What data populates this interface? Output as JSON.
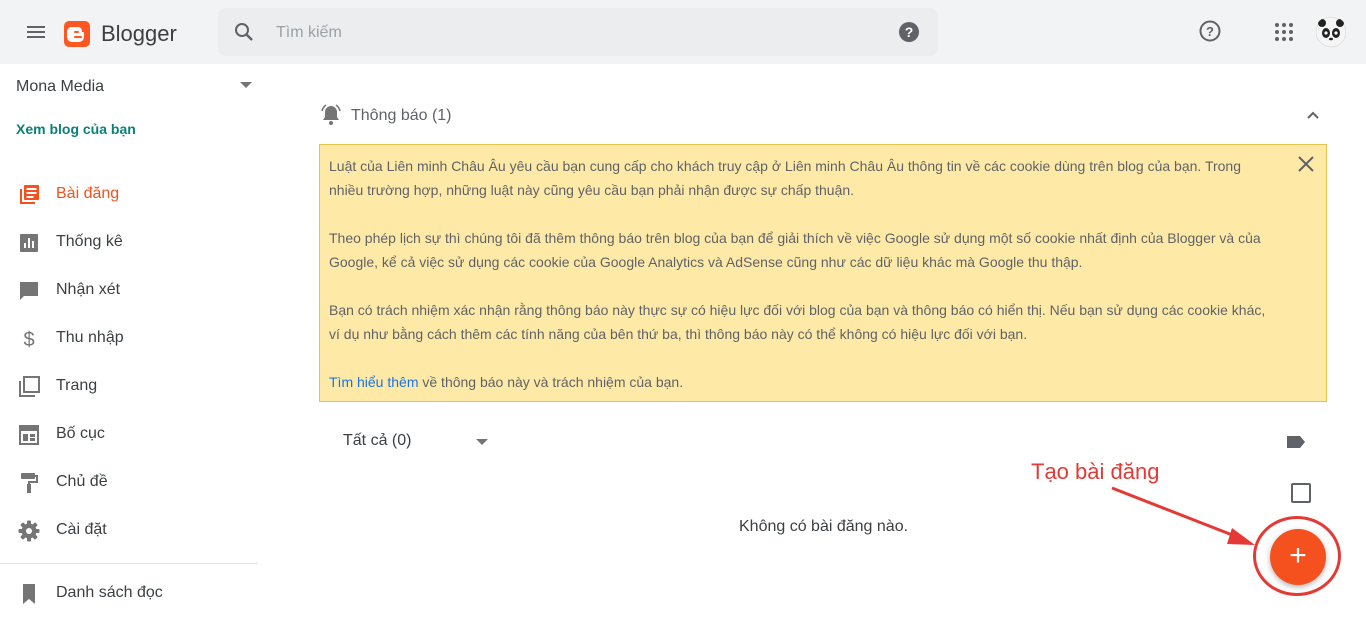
{
  "header": {
    "app_name": "Blogger",
    "search_placeholder": "Tìm kiếm",
    "brand_color": "#ff5722",
    "icons": [
      "menu-icon",
      "blogger-logo",
      "search-icon",
      "help-icon",
      "apps-icon",
      "avatar"
    ]
  },
  "sidebar": {
    "blog_name": "Mona Media",
    "view_blog": "Xem blog của bạn",
    "items": [
      {
        "label": "Bài đăng",
        "icon": "posts-icon",
        "active": true
      },
      {
        "label": "Thống kê",
        "icon": "stats-icon",
        "active": false
      },
      {
        "label": "Nhận xét",
        "icon": "comments-icon",
        "active": false
      },
      {
        "label": "Thu nhập",
        "icon": "dollar-icon",
        "active": false
      },
      {
        "label": "Trang",
        "icon": "pages-icon",
        "active": false
      },
      {
        "label": "Bố cục",
        "icon": "layout-icon",
        "active": false
      },
      {
        "label": "Chủ đề",
        "icon": "paint-roller-icon",
        "active": false
      },
      {
        "label": "Cài đặt",
        "icon": "gear-icon",
        "active": false
      },
      {
        "label": "Danh sách đọc",
        "icon": "bookmark-icon",
        "active": false
      }
    ]
  },
  "notice": {
    "title": "Thông báo (1)",
    "paragraphs": [
      "Luật của Liên minh Châu Âu yêu cầu bạn cung cấp cho khách truy cập ở Liên minh Châu Âu thông tin về các cookie dùng trên blog của bạn. Trong nhiều trường hợp, những luật này cũng yêu cầu bạn phải nhận được sự chấp thuận.",
      "Theo phép lịch sự thì chúng tôi đã thêm thông báo trên blog của bạn để giải thích về việc Google sử dụng một số cookie nhất định của Blogger và của Google, kể cả việc sử dụng các cookie của Google Analytics và AdSense cũng như các dữ liệu khác mà Google thu thập.",
      "Bạn có trách nhiệm xác nhận rằng thông báo này thực sự có hiệu lực đối với blog của bạn và thông báo có hiển thị. Nếu bạn sử dụng các cookie khác, ví dụ như bằng cách thêm các tính năng của bên thứ ba, thì thông báo này có thể không có hiệu lực đối với bạn."
    ],
    "link_text": "Tìm hiểu thêm",
    "link_suffix": " về thông báo này và trách nhiệm của bạn."
  },
  "posts": {
    "filter_label": "Tất cả (0)",
    "empty_text": "Không có bài đăng nào.",
    "fab_label": "+"
  },
  "annotation": {
    "text": "Tạo bài đăng",
    "color": "#e53935"
  }
}
